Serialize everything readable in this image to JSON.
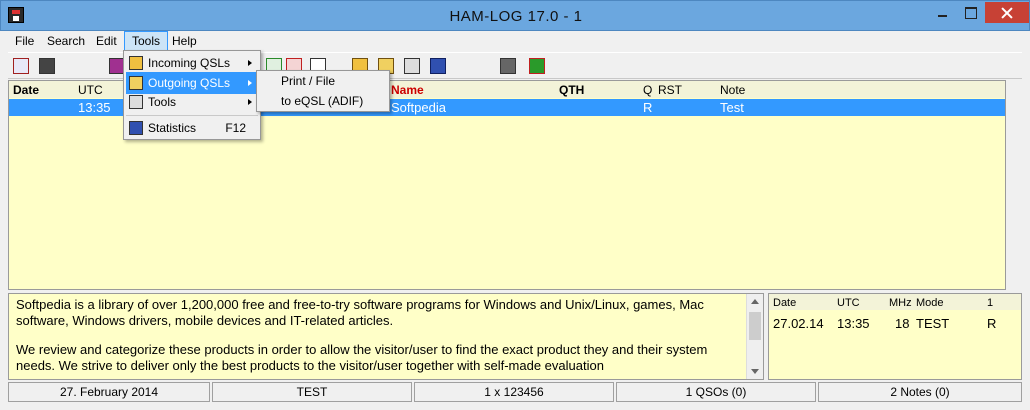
{
  "window": {
    "title": "HAM-LOG  17.0 -  1"
  },
  "menubar": [
    "File",
    "Search",
    "Edit",
    "Tools",
    "Help"
  ],
  "tools_menu": {
    "items": [
      {
        "label": "Incoming QSLs",
        "submenu": true
      },
      {
        "label": "Outgoing QSLs",
        "submenu": true,
        "highlighted": true
      },
      {
        "label": "Tools",
        "submenu": true
      },
      {
        "label": "Statistics",
        "shortcut": "F12"
      }
    ]
  },
  "outgoing_submenu": {
    "items": [
      "Print / File",
      "to eQSL (ADIF)"
    ]
  },
  "log": {
    "columns": [
      "Date",
      "UTC",
      "Name",
      "QTH",
      "Q",
      "RST",
      "Note"
    ],
    "selected_row": {
      "utc": "13:35",
      "name": "Softpedia",
      "q": "R",
      "note": "Test"
    }
  },
  "memo": {
    "paragraphs": [
      "Softpedia is a library of over 1,200,000 free and free-to-try software programs for Windows and Unix/Linux, games, Mac software, Windows drivers, mobile devices and IT-related articles.",
      "We review and categorize these products in order to allow the visitor/user to find the exact product they and their system needs. We strive to deliver only the best products to the visitor/user together with self-made evaluation"
    ]
  },
  "qso_list": {
    "headers": [
      "Date",
      "UTC",
      "MHz",
      "Mode",
      "1"
    ],
    "row": {
      "date": "27.02.14",
      "utc": "13:35",
      "mhz": "18",
      "mode": "TEST",
      "rst": "R"
    }
  },
  "statusbar": [
    "27. February 2014",
    "TEST",
    "1 x 123456",
    "1 QSOs (0)",
    "2 Notes (0)"
  ],
  "colors": {
    "list_bg": "#ffffc8",
    "selection": "#3399ff",
    "name_header": "#cc0000",
    "titlebar": "#6ba7df"
  }
}
